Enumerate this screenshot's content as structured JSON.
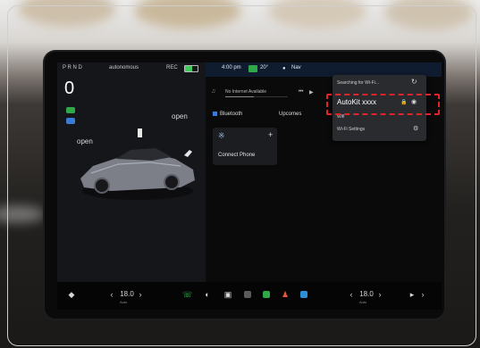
{
  "status_bar": {
    "left_text": "P R N D",
    "center_text": "autonomous",
    "right_text": "REC",
    "battery_text": "0",
    "battery_level": 0.6
  },
  "car_panel": {
    "speed": "0",
    "speed_unit": "",
    "frunk_label": "open",
    "trunk_label": "open"
  },
  "top_bar": {
    "time": "4:00 pm",
    "temp": "20°",
    "user_label": "Nav"
  },
  "media": {
    "now_playing": "No Internet Available",
    "progress": 0.45
  },
  "tabs": {
    "bluetooth": "Bluetooth",
    "wifi": "Upcomes"
  },
  "bluetooth_card": {
    "label": "Connect Phone"
  },
  "wifi_popup": {
    "title": "Searching for Wi-Fi...",
    "network_name": "AutoKit xxxx",
    "wifi_label": "Wifi",
    "settings_label": "Wi-Fi Settings"
  },
  "bottom_bar": {
    "left_temp": "18.0",
    "right_temp": "18.0",
    "left_temp_sub": "Auto",
    "right_temp_sub": "Auto"
  },
  "colors": {
    "highlight": "#e0242c",
    "top_bar": "#0f1b2e"
  }
}
